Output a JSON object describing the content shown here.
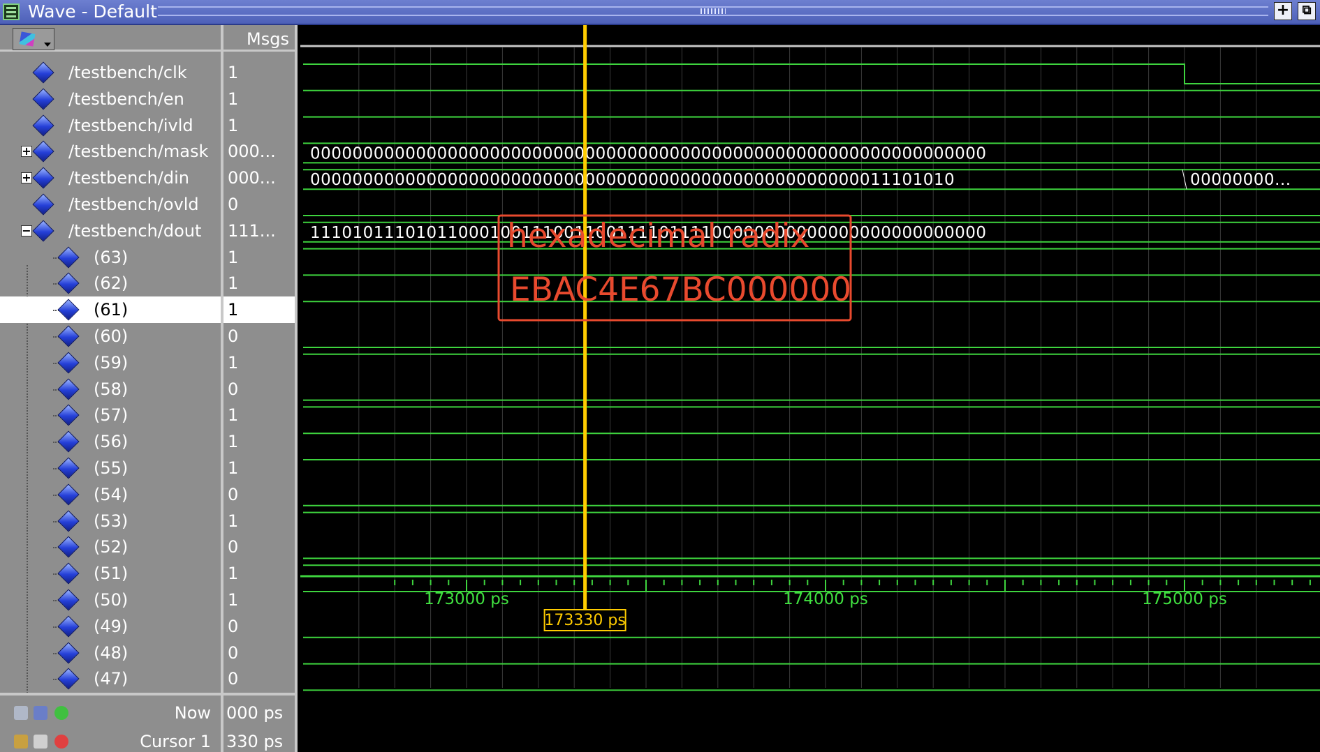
{
  "window": {
    "title": "Wave - Default",
    "buttons": {
      "dock": "+",
      "undock": "⧉"
    }
  },
  "msgs_header": "Msgs",
  "signals": [
    {
      "name": "/testbench/clk",
      "msg": "1",
      "expander": "",
      "level": 0
    },
    {
      "name": "/testbench/en",
      "msg": "1",
      "expander": "",
      "level": 0
    },
    {
      "name": "/testbench/ivld",
      "msg": "1",
      "expander": "",
      "level": 0
    },
    {
      "name": "/testbench/mask",
      "msg": "000...",
      "expander": "+",
      "level": 0
    },
    {
      "name": "/testbench/din",
      "msg": "000...",
      "expander": "+",
      "level": 0
    },
    {
      "name": "/testbench/ovld",
      "msg": "0",
      "expander": "",
      "level": 0
    },
    {
      "name": "/testbench/dout",
      "msg": "111...",
      "expander": "−",
      "level": 0
    },
    {
      "name": "(63)",
      "msg": "1",
      "level": 1
    },
    {
      "name": "(62)",
      "msg": "1",
      "level": 1
    },
    {
      "name": "(61)",
      "msg": "1",
      "level": 1,
      "selected": true
    },
    {
      "name": "(60)",
      "msg": "0",
      "level": 1
    },
    {
      "name": "(59)",
      "msg": "1",
      "level": 1
    },
    {
      "name": "(58)",
      "msg": "0",
      "level": 1
    },
    {
      "name": "(57)",
      "msg": "1",
      "level": 1
    },
    {
      "name": "(56)",
      "msg": "1",
      "level": 1
    },
    {
      "name": "(55)",
      "msg": "1",
      "level": 1
    },
    {
      "name": "(54)",
      "msg": "0",
      "level": 1
    },
    {
      "name": "(53)",
      "msg": "1",
      "level": 1
    },
    {
      "name": "(52)",
      "msg": "0",
      "level": 1
    },
    {
      "name": "(51)",
      "msg": "1",
      "level": 1
    },
    {
      "name": "(50)",
      "msg": "1",
      "level": 1
    },
    {
      "name": "(49)",
      "msg": "0",
      "level": 1
    },
    {
      "name": "(48)",
      "msg": "0",
      "level": 1
    },
    {
      "name": "(47)",
      "msg": "0",
      "level": 1
    }
  ],
  "bus_values": {
    "mask": "0000000000000000000000000000000000000000000000000000000000000000",
    "din": "0000000000000000000000000000000000000000000000000000011101010",
    "din_after": "00000000...",
    "dout": "1110101110101100010011100110011110111100000000000000000000000000"
  },
  "timeline": {
    "ticks": [
      "173000 ps",
      "174000 ps",
      "175000 ps"
    ],
    "cursor_time": "173330 ps"
  },
  "status": {
    "now_label": "Now",
    "now_value": "000 ps",
    "cursor_label": "Cursor 1",
    "cursor_value": "330 ps"
  },
  "annotation": {
    "line1": "hexadecimal radix",
    "line2": "EBAC4E67BC000000"
  },
  "colors": {
    "wave": "#3ed43e",
    "cursor": "#ffcc00",
    "annotation": "#e84a2e"
  }
}
